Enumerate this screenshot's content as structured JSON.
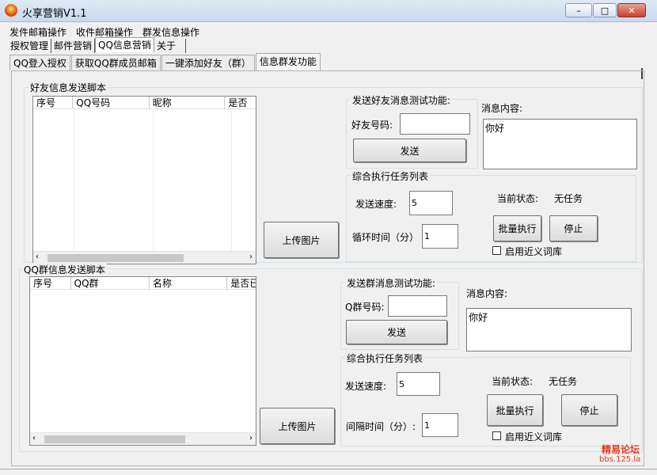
{
  "window": {
    "title": "火享营销V1.1",
    "min": "–",
    "max": "□",
    "close": "✕"
  },
  "menu": [
    "发件邮箱操作",
    "收件邮箱操作",
    "群发信息操作"
  ],
  "tabs1": [
    "授权管理",
    "邮件营销",
    "QQ信息营销",
    "关于"
  ],
  "tabs2": [
    "QQ登入授权",
    "获取QQ群成员邮箱",
    "一键添加好友（群）",
    "信息群发功能"
  ],
  "friend": {
    "group_title": "好友信息发送脚本",
    "columns": [
      "序号",
      "QQ号码",
      "昵称",
      "是否"
    ],
    "upload_label": "上传图片",
    "test": {
      "title": "发送好友消息测试功能:",
      "field_label": "好友号码:",
      "field_value": "",
      "send_label": "发送"
    },
    "message_label": "消息内容:",
    "message_value": "你好",
    "tasks": {
      "title": "综合执行任务列表",
      "speed_label": "发送速度:",
      "speed_value": "5",
      "cycle_label": "循环时间（分）",
      "cycle_value": "1",
      "status_label": "当前状态:",
      "status_value": "无任务",
      "batch_label": "批量执行",
      "stop_label": "停止",
      "thesaurus_label": "启用近义词库"
    }
  },
  "group": {
    "group_title": "QQ群信息发送脚本",
    "columns": [
      "序号",
      "QQ群",
      "名称",
      "是否已"
    ],
    "upload_label": "上传图片",
    "test": {
      "title": "发送群消息测试功能:",
      "field_label": "Q群号码:",
      "field_value": "",
      "send_label": "发送"
    },
    "message_label": "消息内容:",
    "message_value": "你好",
    "tasks": {
      "title": "综合执行任务列表",
      "speed_label": "发送速度:",
      "speed_value": "5",
      "cycle_label": "间隔时间（分）:",
      "cycle_value": "1",
      "status_label": "当前状态:",
      "status_value": "无任务",
      "batch_label": "批量执行",
      "stop_label": "停止",
      "thesaurus_label": "启用近义词库"
    }
  },
  "watermark": {
    "line1": "精易论坛",
    "line2": "bbs.125.la"
  }
}
